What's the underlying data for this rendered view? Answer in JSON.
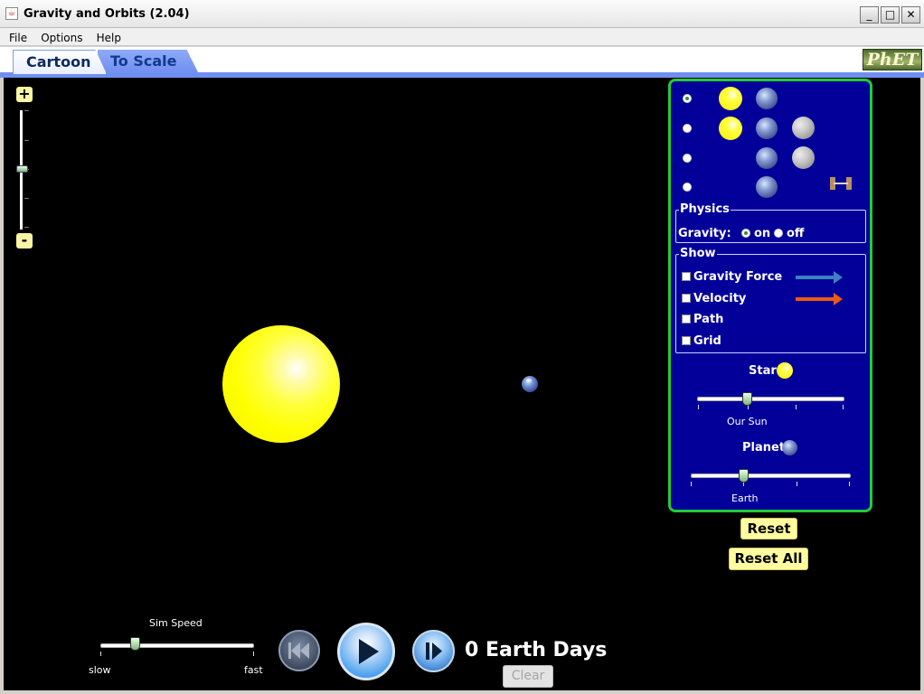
{
  "window": {
    "title": "Gravity and Orbits (2.04)",
    "minimize": "_",
    "maximize": "□",
    "close": "✕"
  },
  "menu": [
    "File",
    "Options",
    "Help"
  ],
  "tabs": {
    "cartoon": "Cartoon",
    "to_scale": "To Scale",
    "selected": "Cartoon"
  },
  "logo": {
    "text": "PhET"
  },
  "zoom": {
    "in": "+",
    "out": "-",
    "level": 0.5
  },
  "presets": [
    {
      "selected": true,
      "bodies": [
        "sun",
        "earth"
      ]
    },
    {
      "selected": false,
      "bodies": [
        "sun",
        "earth",
        "moon"
      ]
    },
    {
      "selected": false,
      "bodies": [
        "earth",
        "moon"
      ]
    },
    {
      "selected": false,
      "bodies": [
        "earth",
        "space-station"
      ]
    }
  ],
  "physics": {
    "title": "Physics",
    "gravity_label": "Gravity:",
    "on": "on",
    "off": "off",
    "gravity_selected": "on"
  },
  "show": {
    "title": "Show",
    "items": [
      {
        "label": "Gravity Force",
        "checked": false
      },
      {
        "label": "Velocity",
        "checked": false
      },
      {
        "label": "Path",
        "checked": false
      },
      {
        "label": "Grid",
        "checked": false
      }
    ],
    "gravity_force_color": "#3f7fc2",
    "velocity_color": "#ec5a12"
  },
  "star": {
    "label": "Star",
    "value_label": "Our Sun",
    "level": 0.35
  },
  "planet": {
    "label": "Planet",
    "value_label": "Earth",
    "level": 0.33
  },
  "buttons": {
    "reset": "Reset",
    "reset_all": "Reset All",
    "clear": "Clear"
  },
  "sim_speed": {
    "label": "Sim Speed",
    "slow": "slow",
    "fast": "fast",
    "level": 0.22
  },
  "time": {
    "display": "0 Earth Days"
  },
  "colors": {
    "panel_bg": "#03009a",
    "panel_border": "#22cc33",
    "space": "#000000",
    "button_yellow": "#fffb9e"
  }
}
